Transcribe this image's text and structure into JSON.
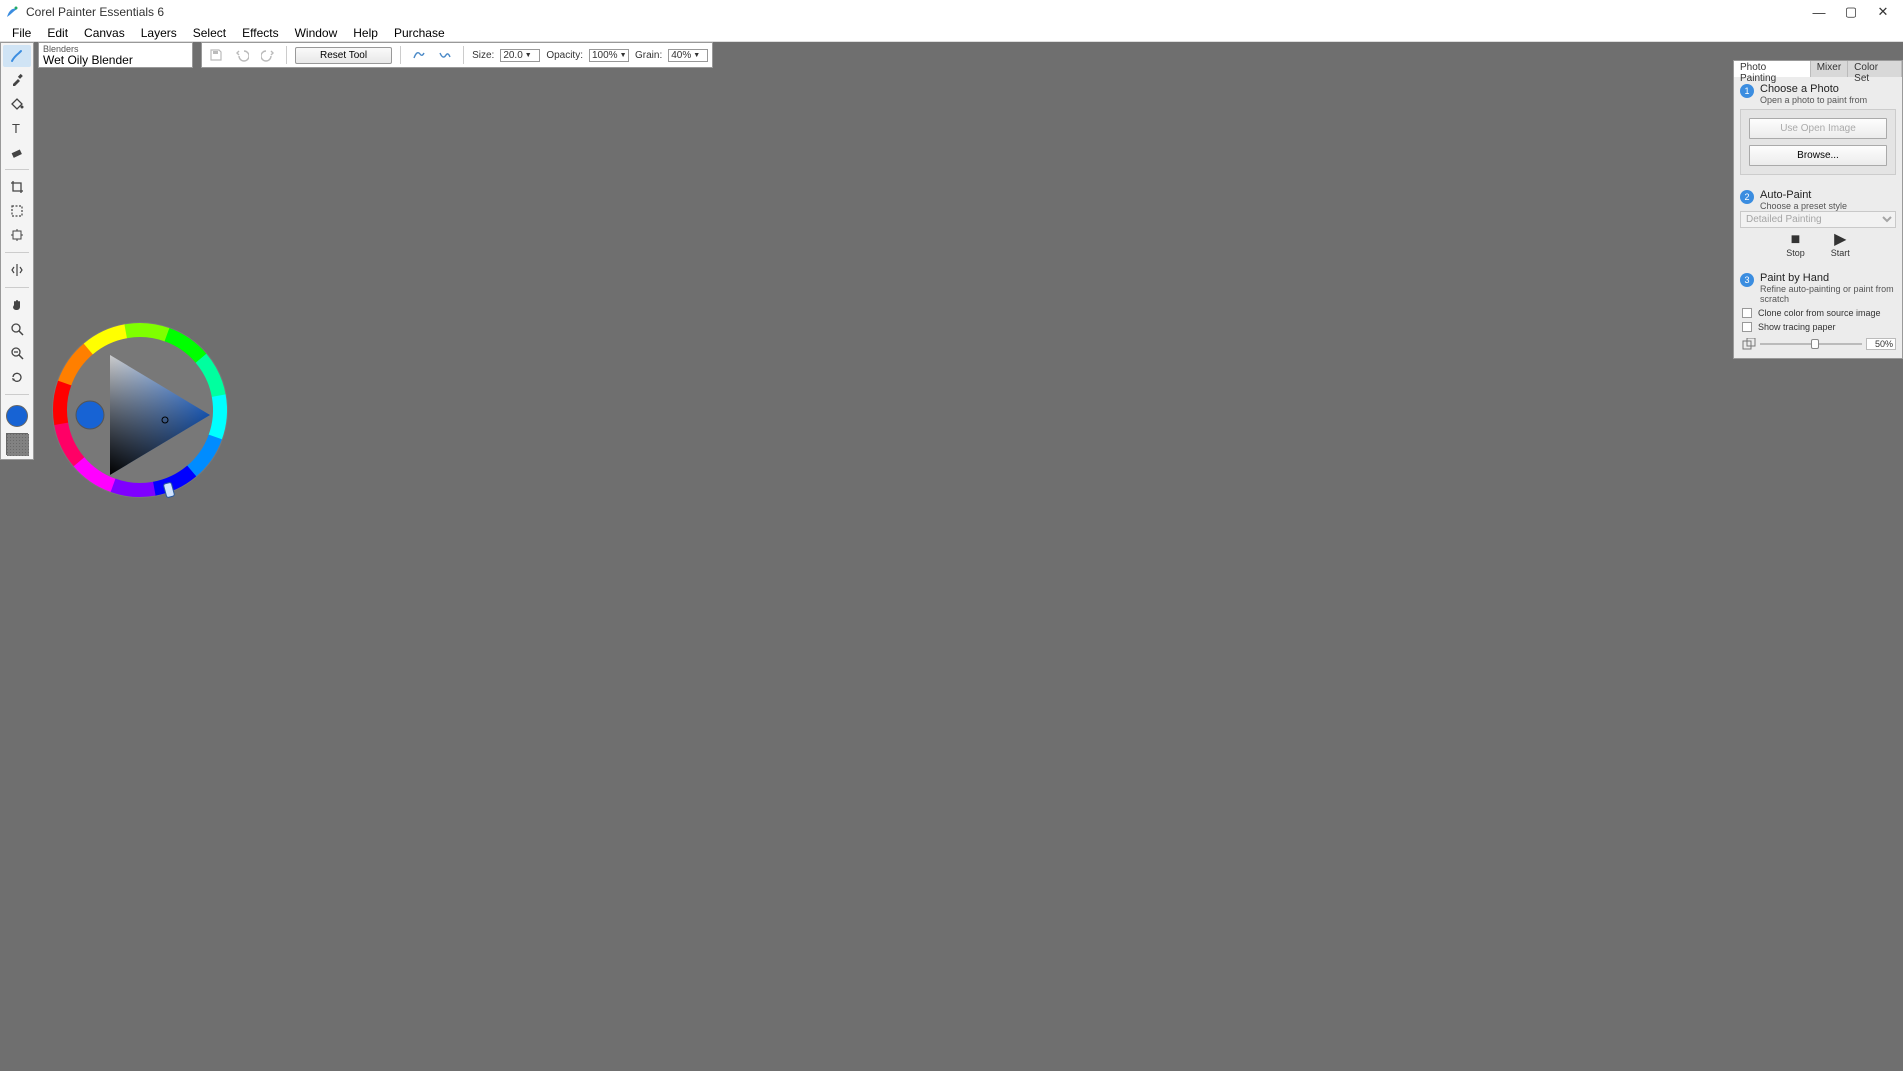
{
  "app": {
    "title": "Corel Painter Essentials 6"
  },
  "window_controls": {
    "min": "—",
    "max": "▢",
    "close": "✕"
  },
  "menus": [
    "File",
    "Edit",
    "Canvas",
    "Layers",
    "Select",
    "Effects",
    "Window",
    "Help",
    "Purchase"
  ],
  "brush": {
    "category": "Blenders",
    "variant": "Wet Oily Blender"
  },
  "propbar": {
    "reset": "Reset Tool",
    "size_label": "Size:",
    "size_value": "20.0",
    "opacity_label": "Opacity:",
    "opacity_value": "100%",
    "grain_label": "Grain:",
    "grain_value": "40%"
  },
  "current_color": "#1763d4",
  "panel": {
    "tabs": [
      "Photo Painting",
      "Mixer",
      "Color Set"
    ],
    "step1": {
      "num": "1",
      "title": "Choose a Photo",
      "desc": "Open a photo to paint from",
      "use_open": "Use Open Image",
      "browse": "Browse..."
    },
    "step2": {
      "num": "2",
      "title": "Auto-Paint",
      "desc": "Choose a preset style",
      "preset": "Detailed Painting",
      "stop": "Stop",
      "start": "Start"
    },
    "step3": {
      "num": "3",
      "title": "Paint by Hand",
      "desc": "Refine auto-painting or paint from scratch",
      "clone_label": "Clone color from source image",
      "tracing_label": "Show tracing paper",
      "tracing_pct": "50%"
    }
  }
}
